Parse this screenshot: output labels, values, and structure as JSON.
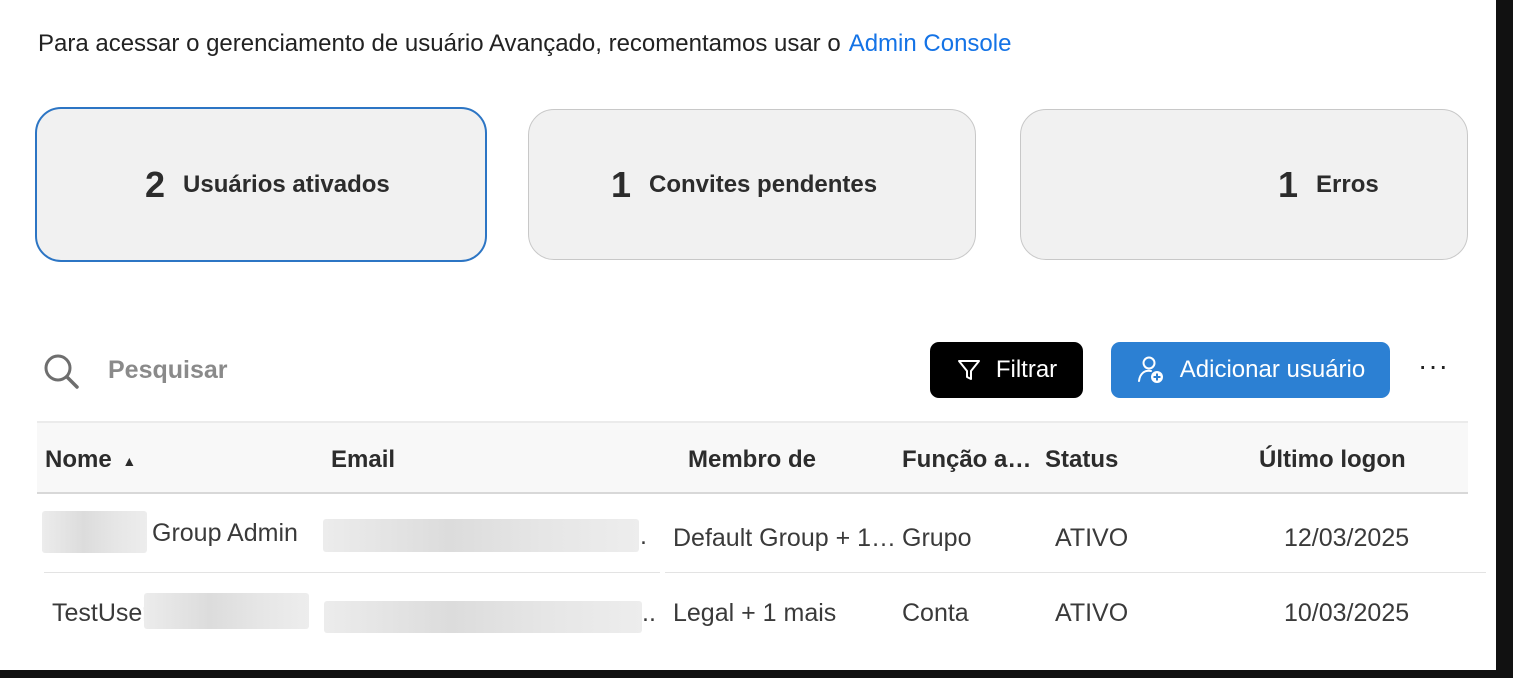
{
  "intro": {
    "text": "Para acessar o gerenciamento de usuário Avançado, recomentamos usar o",
    "link": "Admin Console"
  },
  "cards": [
    {
      "count": "2",
      "label": "Usuários ativados",
      "selected": true
    },
    {
      "count": "1",
      "label": "Convites pendentes",
      "selected": false
    },
    {
      "count": "1",
      "label": "Erros",
      "selected": false
    }
  ],
  "toolbar": {
    "search_placeholder": "Pesquisar",
    "filter_label": "Filtrar",
    "add_user_label": "Adicionar usuário",
    "more_label": "···"
  },
  "table": {
    "columns": [
      "Nome",
      "Email",
      "Membro de",
      "Função a…",
      "Status",
      "Último logon"
    ],
    "sort_indicator": "▲",
    "rows": [
      {
        "name": "Group Admin",
        "email_suffix": ".",
        "member_of": "Default Group + 1…",
        "role": "Grupo",
        "status": "ATIVO",
        "last_logon": "12/03/2025"
      },
      {
        "name": "TestUser",
        "email_suffix": "..",
        "member_of": "Legal + 1 mais",
        "role": "Conta",
        "status": "ATIVO",
        "last_logon": "10/03/2025"
      }
    ]
  },
  "colors": {
    "link": "#1473e6",
    "accent_button": "#2c80d3",
    "selected_border": "#2c75c4",
    "filter_button": "#000000"
  },
  "icons": {
    "search": "search-icon",
    "filter": "filter-icon",
    "add_user": "add-user-icon",
    "more": "more-icon",
    "sort": "sort-ascending-icon"
  }
}
